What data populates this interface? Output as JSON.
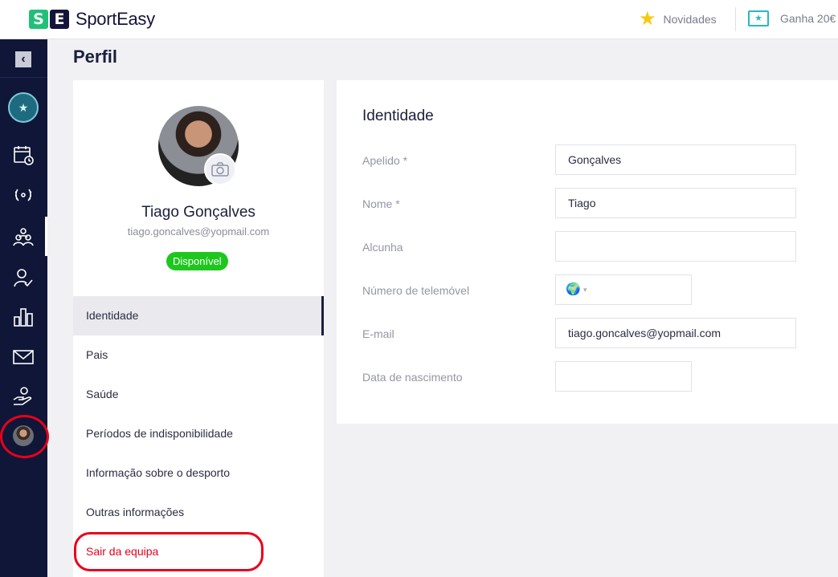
{
  "header": {
    "brand_mark_s": "S",
    "brand_mark_e": "E",
    "brand_name": "SportEasy",
    "news_label": "Novidades",
    "earn_label": "Ganha 20€"
  },
  "sidebar": {
    "collapse_label": "‹",
    "items": [
      "calendar-icon",
      "trophy-icon",
      "team-icon",
      "attendance-icon",
      "stats-icon",
      "mail-icon",
      "donation-icon"
    ]
  },
  "page": {
    "title": "Perfil"
  },
  "profile": {
    "name": "Tiago Gonçalves",
    "email": "tiago.goncalves@yopmail.com",
    "status": "Disponível"
  },
  "menu": {
    "items": [
      "Identidade",
      "Pais",
      "Saúde",
      "Períodos de indisponibilidade",
      "Informação sobre o desporto",
      "Outras informações",
      "Sair da equipa"
    ]
  },
  "form": {
    "section_title": "Identidade",
    "fields": [
      {
        "label": "Apelido *",
        "value": "Gonçalves"
      },
      {
        "label": "Nome *",
        "value": "Tiago"
      },
      {
        "label": "Alcunha",
        "value": ""
      },
      {
        "label": "Número de telemóvel",
        "value": ""
      },
      {
        "label": "E-mail",
        "value": "tiago.goncalves@yopmail.com"
      },
      {
        "label": "Data de nascimento",
        "value": ""
      }
    ],
    "phone_flag": "🌍",
    "phone_caret": "▾"
  },
  "colors": {
    "sidebar_bg": "#0f1637",
    "status_green": "#1ec71e",
    "danger_red": "#e8001c",
    "brand_green": "#21c07a"
  }
}
